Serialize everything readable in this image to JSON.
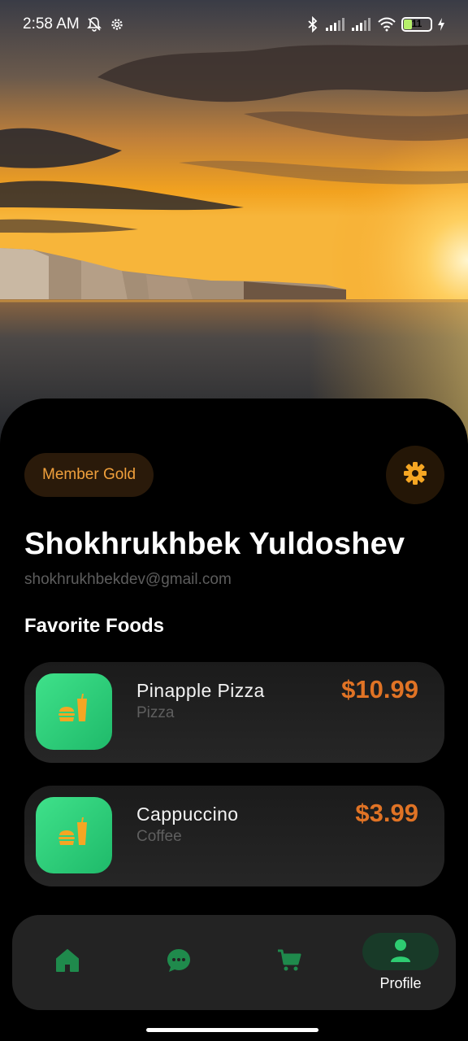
{
  "status_bar": {
    "time": "2:58 AM",
    "battery_level": "11",
    "icons": [
      "bell-off-icon",
      "settings-gear-icon",
      "bluetooth-icon",
      "signal-icon",
      "signal-icon",
      "wifi-icon",
      "battery-icon",
      "charging-icon"
    ]
  },
  "profile": {
    "membership": "Member Gold",
    "name": "Shokhrukhbek Yuldoshev",
    "email": "shokhrukhbekdev@gmail.com"
  },
  "favorites": {
    "title": "Favorite Foods",
    "items": [
      {
        "name": "Pinapple Pizza",
        "category": "Pizza",
        "price": "$10.99",
        "icon": "burger-drink-icon"
      },
      {
        "name": "Cappuccino",
        "category": "Coffee",
        "price": "$3.99",
        "icon": "burger-drink-icon"
      }
    ]
  },
  "nav": {
    "items": [
      {
        "id": "home",
        "icon": "home-icon"
      },
      {
        "id": "chat",
        "icon": "chat-icon"
      },
      {
        "id": "cart",
        "icon": "cart-icon"
      },
      {
        "id": "profile",
        "icon": "profile-icon",
        "label": "Profile",
        "active": true
      }
    ]
  },
  "colors": {
    "accent_orange": "#e07325",
    "badge_text": "#f0a03c",
    "green": "#2ecc71",
    "nav_active_pill": "#183a28"
  }
}
